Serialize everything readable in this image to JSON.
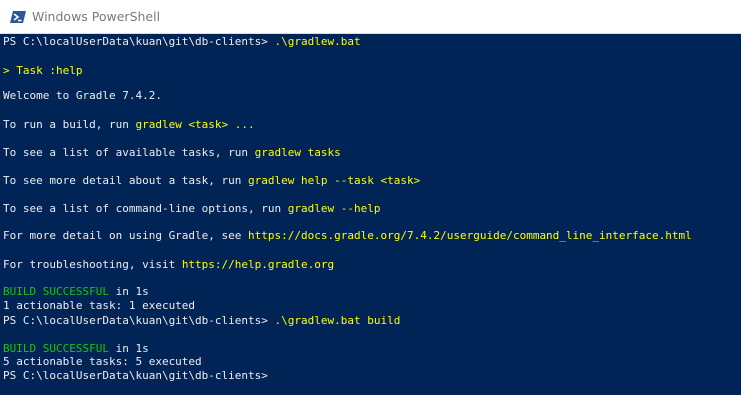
{
  "window": {
    "title": "Windows PowerShell",
    "icon": "powershell-icon"
  },
  "colors": {
    "background": "#012456",
    "text": "#eeedf0",
    "highlight": "#ffff00",
    "success": "#16c60c"
  },
  "console": {
    "lines": [
      {
        "segments": [
          {
            "text": "PS C:\\localUserData\\kuan\\git\\db-clients> ",
            "style": "w"
          },
          {
            "text": ".\\gradlew.bat",
            "style": "y"
          }
        ]
      },
      {
        "segments": [
          {
            "text": "> Task :help",
            "style": "y"
          }
        ]
      },
      {
        "segments": [
          {
            "text": "Welcome to Gradle 7.4.2.",
            "style": "w"
          }
        ]
      },
      {
        "segments": [
          {
            "text": "To run a build, run ",
            "style": "w"
          },
          {
            "text": "gradlew <task> ...",
            "style": "y"
          }
        ]
      },
      {
        "segments": [
          {
            "text": "To see a list of available tasks, run ",
            "style": "w"
          },
          {
            "text": "gradlew tasks",
            "style": "y"
          }
        ]
      },
      {
        "segments": [
          {
            "text": "To see more detail about a task, run ",
            "style": "w"
          },
          {
            "text": "gradlew help --task <task>",
            "style": "y"
          }
        ]
      },
      {
        "segments": [
          {
            "text": "To see a list of command-line options, run ",
            "style": "w"
          },
          {
            "text": "gradlew --help",
            "style": "y"
          }
        ]
      },
      {
        "segments": [
          {
            "text": "For more detail on using Gradle, see ",
            "style": "w"
          },
          {
            "text": "https://docs.gradle.org/7.4.2/userguide/command_line_interface.html",
            "style": "y"
          }
        ]
      },
      {
        "segments": [
          {
            "text": "For troubleshooting, visit ",
            "style": "w"
          },
          {
            "text": "https://help.gradle.org",
            "style": "y"
          }
        ]
      },
      {
        "segments": [
          {
            "text": "BUILD SUCCESSFUL",
            "style": "g"
          },
          {
            "text": " in 1s",
            "style": "w"
          }
        ]
      },
      {
        "segments": [
          {
            "text": "1 actionable task: 1 executed",
            "style": "w"
          }
        ]
      },
      {
        "segments": [
          {
            "text": "PS C:\\localUserData\\kuan\\git\\db-clients> ",
            "style": "w"
          },
          {
            "text": ".\\gradlew.bat build",
            "style": "y"
          }
        ]
      },
      {
        "segments": [
          {
            "text": "BUILD SUCCESSFUL",
            "style": "g"
          },
          {
            "text": " in 1s",
            "style": "w"
          }
        ]
      },
      {
        "segments": [
          {
            "text": "5 actionable tasks: 5 executed",
            "style": "w"
          }
        ]
      },
      {
        "segments": [
          {
            "text": "PS C:\\localUserData\\kuan\\git\\db-clients>",
            "style": "w"
          }
        ]
      }
    ]
  }
}
